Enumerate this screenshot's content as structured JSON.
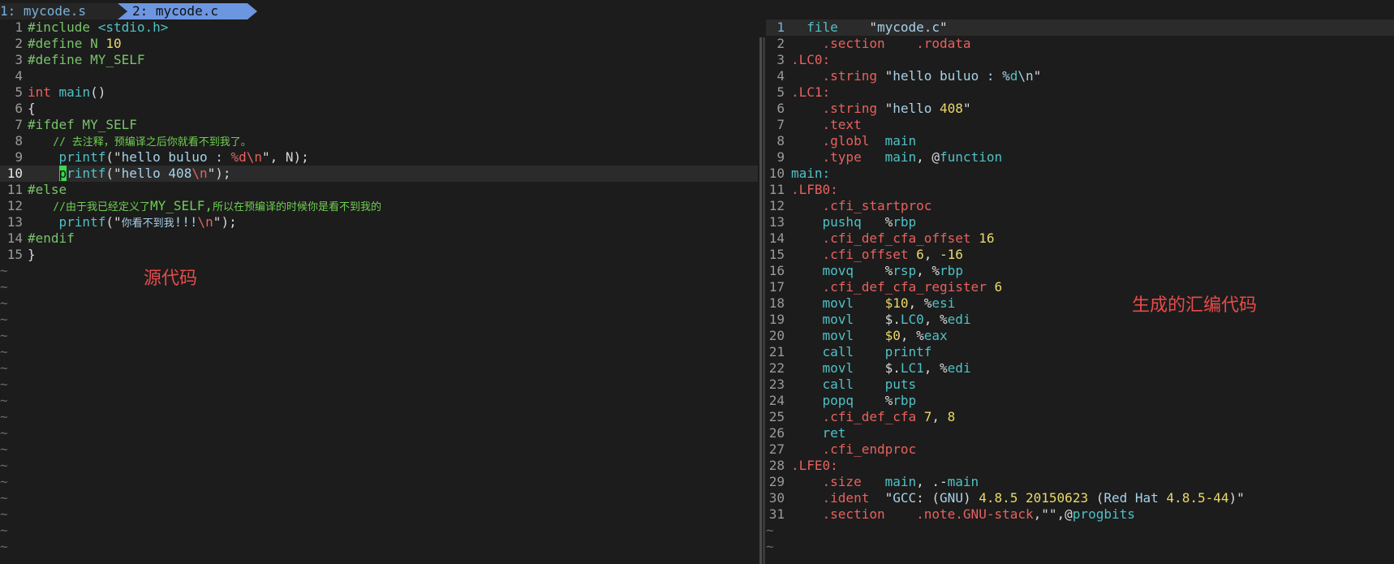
{
  "tabs": [
    {
      "label": "1: mycode.s"
    },
    {
      "label": "2: mycode.c"
    }
  ],
  "annotations": {
    "source": "源代码",
    "generated": "生成的汇编代码"
  },
  "left_lines": [
    "1",
    "2",
    "3",
    "4",
    "5",
    "6",
    "7",
    "8",
    "9",
    "10",
    "11",
    "12",
    "13",
    "14",
    "15"
  ],
  "right_lines": [
    "1",
    "2",
    "3",
    "4",
    "5",
    "6",
    "7",
    "8",
    "9",
    "10",
    "11",
    "12",
    "13",
    "14",
    "15",
    "16",
    "17",
    "18",
    "19",
    "20",
    "21",
    "22",
    "23",
    "24",
    "25",
    "26",
    "27",
    "28",
    "29",
    "30",
    "31"
  ],
  "src": {
    "l1a": "#include ",
    "l1b": "<stdio.h>",
    "l2a": "#define N ",
    "l2b": "10",
    "l3": "#define MY_SELF",
    "l5a": "int",
    "l5b": " ",
    "l5c": "main",
    "l5d": "()",
    "l6": "{",
    "l7": "#ifdef MY_SELF",
    "l8": "    // 去注释，预编译之后你就看不到我了。",
    "l9a": "    ",
    "l9b": "printf",
    "l9c": "(",
    "l9d": "\"",
    "l9e": "hello buluo : ",
    "l9f": "%d\\n",
    "l9g": "\"",
    "l9h": ", N);",
    "l10a": "    ",
    "l10b": "p",
    "l10c": "rintf",
    "l10d": "(",
    "l10e": "\"",
    "l10f": "hello 408",
    "l10g": "\\n",
    "l10h": "\"",
    "l10i": ");",
    "l11": "#else",
    "l12a": "    //由于我已经定义了",
    "l12b": "MY_SELF,",
    "l12c": "所以在预编译的时候你是看不到我的",
    "l13a": "    ",
    "l13b": "printf",
    "l13c": "(",
    "l13d": "\"",
    "l13e": "你看不到我",
    "l13f": "!!!",
    "l13g": "\\n",
    "l13h": "\"",
    "l13i": ");",
    "l14": "#endif",
    "l15": "}"
  },
  "asm": {
    "r1a": "  file    ",
    "r1b": "\"",
    "r1c": "mycode.c",
    "r1d": "\"",
    "r2a": "    .section    ",
    "r2b": ".rodata",
    "r3": ".LC0:",
    "r4a": "    .string ",
    "r4b": "\"",
    "r4c": "hello buluo : %",
    "r4d": "d",
    "r4e": "\\n",
    "r4f": "\"",
    "r5": ".LC1:",
    "r6a": "    .string ",
    "r6b": "\"",
    "r6c": "hello ",
    "r6d": "408",
    "r6e": "\"",
    "r7": "    .text",
    "r8a": "    .globl  ",
    "r8b": "main",
    "r9a": "    .type   ",
    "r9b": "main",
    "r9c": ", @",
    "r9d": "function",
    "r10": "main:",
    "r11": ".LFB0:",
    "r12": "    .cfi_startproc",
    "r13a": "    pushq   ",
    "r13b": "%",
    "r13c": "rbp",
    "r14a": "    .cfi_def_cfa_offset ",
    "r14b": "16",
    "r15a": "    .cfi_offset ",
    "r15b": "6",
    "r15c": ", ",
    "r15d": "-16",
    "r16a": "    movq    ",
    "r16b": "%",
    "r16c": "rsp",
    "r16d": ", %",
    "r16e": "rbp",
    "r17a": "    .cfi_def_cfa_register ",
    "r17b": "6",
    "r18a": "    movl    ",
    "r18b": "$10",
    "r18c": ", %",
    "r18d": "esi",
    "r19a": "    movl    ",
    "r19b": "$.",
    "r19c": "LC0",
    "r19d": ", %",
    "r19e": "edi",
    "r20a": "    movl    ",
    "r20b": "$0",
    "r20c": ", %",
    "r20d": "eax",
    "r21a": "    call    ",
    "r21b": "printf",
    "r22a": "    movl    ",
    "r22b": "$.",
    "r22c": "LC1",
    "r22d": ", %",
    "r22e": "edi",
    "r23a": "    call    ",
    "r23b": "puts",
    "r24a": "    popq    ",
    "r24b": "%",
    "r24c": "rbp",
    "r25a": "    .cfi_def_cfa ",
    "r25b": "7",
    "r25c": ", ",
    "r25d": "8",
    "r26": "    ret",
    "r27": "    .cfi_endproc",
    "r28": ".LFE0:",
    "r29a": "    .size   ",
    "r29b": "main",
    "r29c": ", .-",
    "r29d": "main",
    "r30a": "    .ident  ",
    "r30b": "\"",
    "r30c": "GCC",
    "r30d": ": (",
    "r30e": "GNU",
    "r30f": ") ",
    "r30g": "4.8.5 20150623",
    "r30h": " (",
    "r30i": "Red Hat",
    "r30j": " ",
    "r30k": "4.8.5-44",
    "r30l": ")\"",
    "r31a": "    .section    ",
    "r31b": ".note.GNU-stack",
    "r31c": ",\"\",@",
    "r31d": "progbits"
  },
  "tilde": "~"
}
